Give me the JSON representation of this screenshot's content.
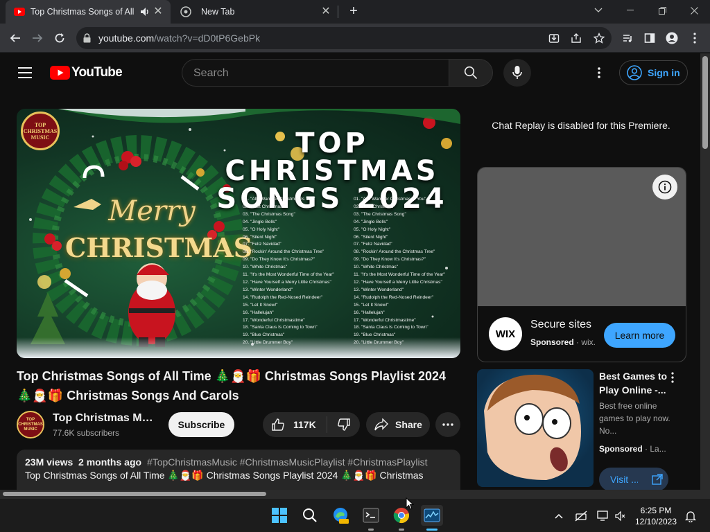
{
  "browser": {
    "tabs": [
      {
        "title": "Top Christmas Songs of All Time",
        "active": true
      },
      {
        "title": "New Tab",
        "active": false
      }
    ],
    "url_host": "youtube.com",
    "url_path": "/watch?v=dD0tP6GebPk"
  },
  "youtube": {
    "logo_text": "YouTube",
    "search_placeholder": "Search",
    "sign_in_label": "Sign in",
    "thumbnail": {
      "badge": "TOP CHRISTMAS MUSIC",
      "title_line1": "TOP CHRISTMAS",
      "title_line2": "SONGS 2024",
      "merry": "Merry",
      "christmas": "CHRISTMAS",
      "songs": [
        "01. \"All I Want for Christmas Is You\"",
        "02. \"Last Christmas\"",
        "03. \"The Christmas Song\"",
        "04. \"Jingle Bells\"",
        "05. \"O Holy Night\"",
        "06. \"Silent Night\"",
        "07. \"Feliz Navidad\"",
        "08. \"Rockin' Around the Christmas Tree\"",
        "09. \"Do They Know It's Christmas?\"",
        "10. \"White Christmas\"",
        "11. \"It's the Most Wonderful Time of the Year\"",
        "12. \"Have Yourself a Merry Little Christmas\"",
        "13. \"Winter Wonderland\"",
        "14. \"Rudolph the Red-Nosed Reindeer\"",
        "15. \"Let It Snow!\"",
        "16. \"Hallelujah\"",
        "17. \"Wonderful Christmastime\"",
        "18. \"Santa Claus Is Coming to Town\"",
        "19. \"Blue Christmas\"",
        "20. \"Little Drummer Boy\""
      ]
    },
    "video_title": "Top Christmas Songs of All Time 🎄🎅🎁 Christmas Songs Playlist 2024 🎄🎅🎁 Christmas Songs And Carols",
    "channel_avatar_text": "TOP CHRISTMAS MUSIC",
    "channel_name": "Top Christmas Music",
    "channel_subs": "77.6K subscribers",
    "subscribe_label": "Subscribe",
    "like_count": "117K",
    "share_label": "Share",
    "description": {
      "views": "23M views",
      "age": "2 months ago",
      "tags": "#TopChristmasMusic #ChristmasMusicPlaylist #ChristmasPlaylist",
      "first_line": "Top Christmas Songs of All Time 🎄🎅🎁 Christmas Songs Playlist 2024 🎄🎅🎁 Christmas"
    },
    "chat_replay": "Chat Replay is disabled for this Premiere.",
    "ad": {
      "logo": "WIX",
      "title": "Secure sites",
      "sponsored": "Sponsored",
      "domain": "wix.",
      "cta": "Learn more"
    },
    "recommendation": {
      "title": "Best Games to Play Online -...",
      "description": "Best free online games to play now. No...",
      "sponsored": "Sponsored",
      "advertiser": "La...",
      "cta": "Visit ..."
    }
  },
  "taskbar": {
    "time": "6:25 PM",
    "date": "12/10/2023"
  },
  "colors": {
    "youtube_red": "#ff0000",
    "link_blue": "#3ea6ff",
    "page_bg": "#0f0f0f"
  }
}
